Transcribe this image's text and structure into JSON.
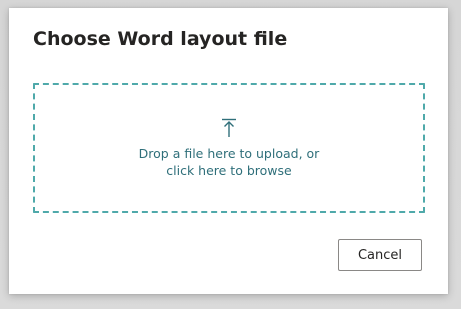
{
  "dialog": {
    "title": "Choose Word layout file",
    "dropzone": {
      "icon": "upload-arrow-icon",
      "line1": "Drop a file here to upload, or",
      "line2": "click here to browse"
    },
    "cancel_label": "Cancel"
  },
  "colors": {
    "dropzone_border": "#4fa9aa",
    "dropzone_text": "#2f6f7a",
    "title_text": "#252423"
  }
}
